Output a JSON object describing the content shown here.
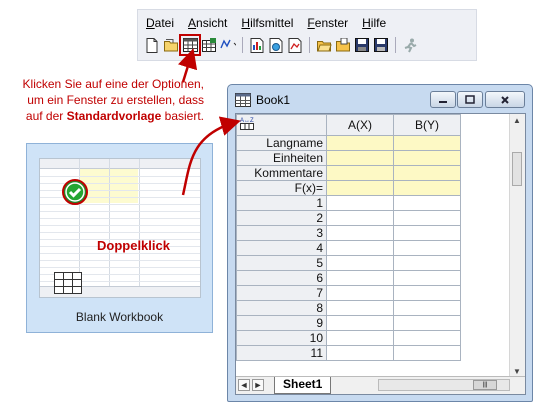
{
  "menu": {
    "items": [
      {
        "key": "D",
        "rest": "atei"
      },
      {
        "key": "A",
        "rest": "nsicht"
      },
      {
        "key": "H",
        "rest": "ilfsmittel"
      },
      {
        "key": "F",
        "rest": "enster"
      },
      {
        "key": "H",
        "rest": "ilfe"
      }
    ]
  },
  "toolbar": {
    "icons": [
      "new-project-icon",
      "open-folder-icon",
      "new-workbook-icon",
      "new-excel-icon",
      "new-matrix-icon",
      "new-graph-icon",
      "new-function-icon",
      "new-layout-icon",
      "new-notes-icon",
      "open-icon",
      "open-template-icon",
      "save-project-icon",
      "save-template-icon",
      "runner-icon"
    ]
  },
  "annotation": {
    "line_pre": "Klicken Sie auf eine der Optionen, um ein Fenster zu erstellen, dass auf der",
    "bold": "Standardvorlage",
    "line_post": " basiert."
  },
  "preview": {
    "action": "Doppelklick",
    "label": "Blank Workbook"
  },
  "window": {
    "title": "Book1",
    "columns": [
      "A(X)",
      "B(Y)"
    ],
    "label_rows": [
      "Langname",
      "Einheiten",
      "Kommentare",
      "F(x)="
    ],
    "data_rows": [
      "1",
      "2",
      "3",
      "4",
      "5",
      "6",
      "7",
      "8",
      "9",
      "10",
      "11"
    ],
    "sheet_tab": "Sheet1"
  },
  "colors": {
    "accent_red": "#c00000",
    "label_row_yellow": "#fdf9c5",
    "window_frame": "#c7daf0"
  }
}
